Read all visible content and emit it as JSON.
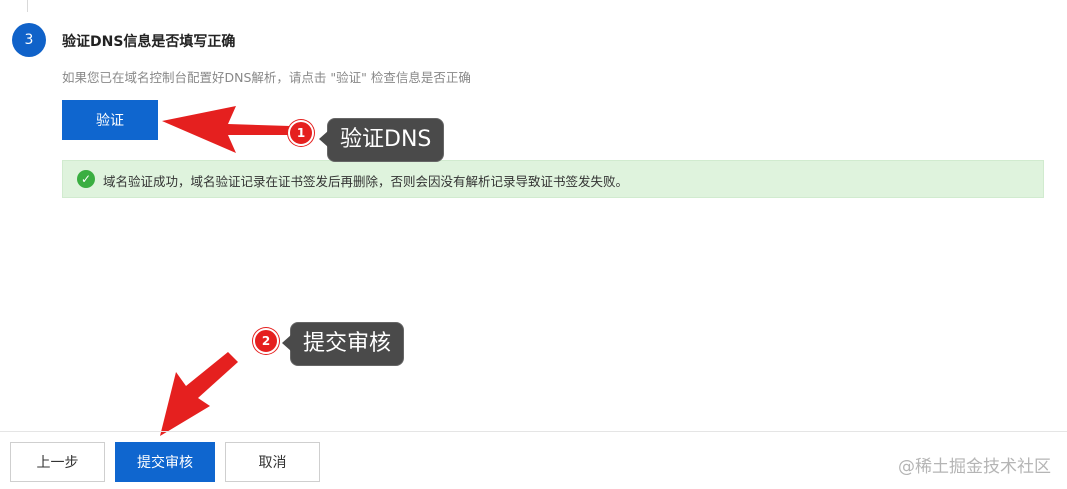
{
  "step": {
    "number": "3",
    "title": "验证DNS信息是否填写正确",
    "description": "如果您已在域名控制台配置好DNS解析，请点击 \"验证\" 检查信息是否正确",
    "verify_label": "验证"
  },
  "alert": {
    "icon": "check-circle-icon",
    "text": "域名验证成功，域名验证记录在证书签发后再删除，否则会因没有解析记录导致证书签发失败。"
  },
  "annotations": [
    {
      "number": "1",
      "label": "验证DNS"
    },
    {
      "number": "2",
      "label": "提交审核"
    }
  ],
  "footer": {
    "prev_label": "上一步",
    "submit_label": "提交审核",
    "cancel_label": "取消"
  },
  "watermark": "@稀土掘金技术社区",
  "colors": {
    "primary": "#0f66cf",
    "success_bg": "#dff3dd",
    "success_icon": "#3aae41",
    "annotation_red": "#e5201f",
    "bubble_bg": "#4a4a4a"
  }
}
